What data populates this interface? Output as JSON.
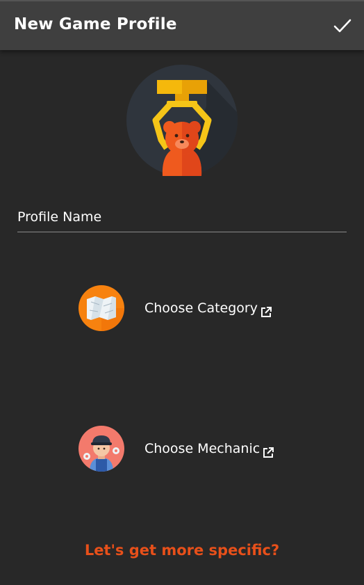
{
  "appbar": {
    "title": "New Game Profile",
    "confirm_icon": "check-icon"
  },
  "avatar": {
    "icon": "claw-machine-bear-icon"
  },
  "profile_name": {
    "value": "",
    "placeholder": "Profile Name"
  },
  "category": {
    "label": "Choose Category",
    "icon": "map-icon",
    "link_icon": "external-link-icon"
  },
  "mechanic": {
    "label": "Choose Mechanic",
    "icon": "mechanic-icon",
    "link_icon": "external-link-icon"
  },
  "more": {
    "label": "Let's get more specific?"
  },
  "colors": {
    "background": "#282828",
    "appbar": "#3f3f3f",
    "accent": "#e8501a",
    "category_circle": "#f7820f",
    "mechanic_circle": "#f37a6c"
  }
}
